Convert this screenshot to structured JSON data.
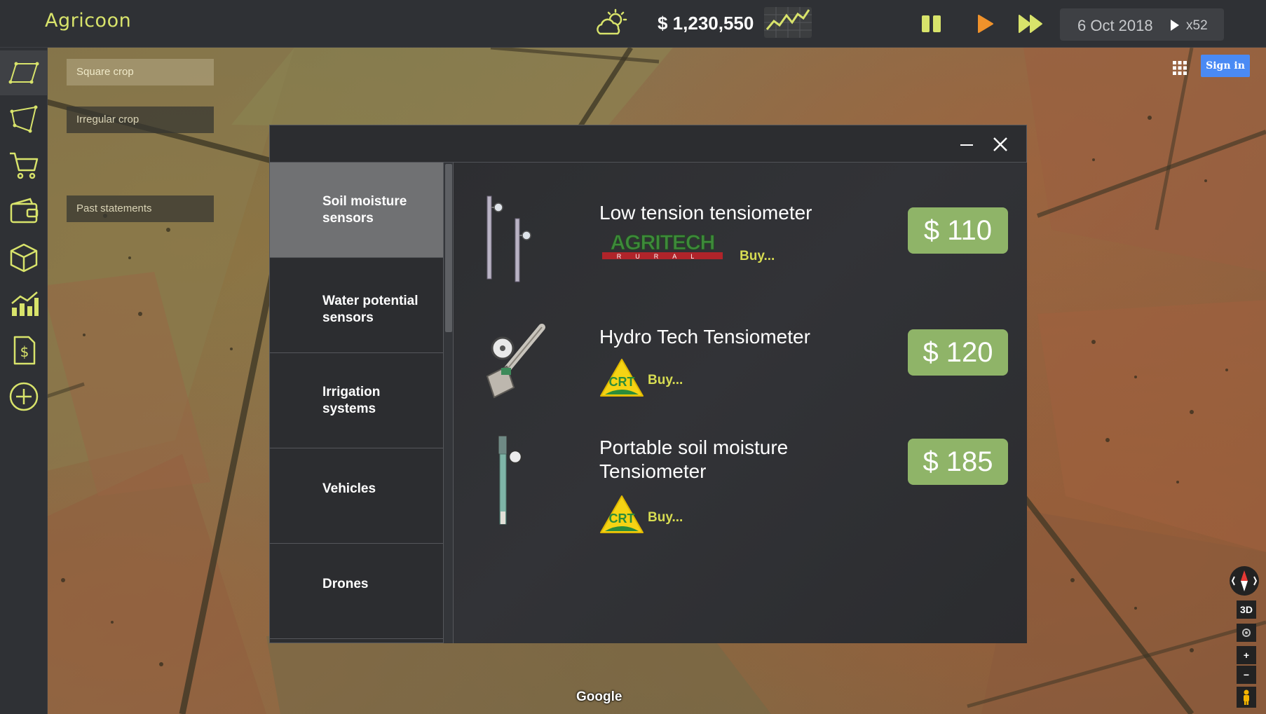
{
  "app": {
    "title": "Agricoon"
  },
  "topbar": {
    "weather_icon": "partly-sunny-icon",
    "balance": "$ 1,230,550",
    "trend_icon": "line-chart-icon",
    "controls": [
      "pause-icon",
      "play-icon",
      "fast-forward-icon"
    ],
    "date": "6 Oct 2018",
    "speed": "x52"
  },
  "sidebar": {
    "tools": [
      "square-crop-icon",
      "irregular-crop-icon",
      "cart-icon",
      "wallet-icon",
      "box-icon",
      "stats-chart-icon",
      "invoice-dollar-icon",
      "add-circle-icon"
    ],
    "flyouts": {
      "square_crop": "Square crop",
      "irregular_crop": "Irregular crop",
      "past_statements": "Past statements"
    }
  },
  "map_controls": {
    "sign_in": "Sign in",
    "view_3d": "3D",
    "zoom_in": "+",
    "zoom_out": "−",
    "attribution": "Google"
  },
  "store": {
    "categories": [
      {
        "label": "Soil moisture sensors",
        "active": true
      },
      {
        "label": "Water potential sensors",
        "active": false
      },
      {
        "label": "Irrigation systems",
        "active": false
      },
      {
        "label": "Vehicles",
        "active": false
      },
      {
        "label": "Drones",
        "active": false
      }
    ],
    "products": [
      {
        "name": "Low tension tensiometer",
        "brand": "AGRITECH",
        "brand_sub": "RURAL",
        "buy": "Buy...",
        "price": "$ 110"
      },
      {
        "name": "Hydro Tech Tensiometer",
        "brand": "CRT",
        "buy": "Buy...",
        "price": "$ 120"
      },
      {
        "name": "Portable soil moisture Tensiometer",
        "brand": "CRT",
        "buy": "Buy...",
        "price": "$ 185"
      }
    ]
  },
  "colors": {
    "accent_yellow": "#d8e36b",
    "price_green": "#8fb468",
    "play_orange": "#f0922b",
    "signin_blue": "#4a8af4"
  }
}
